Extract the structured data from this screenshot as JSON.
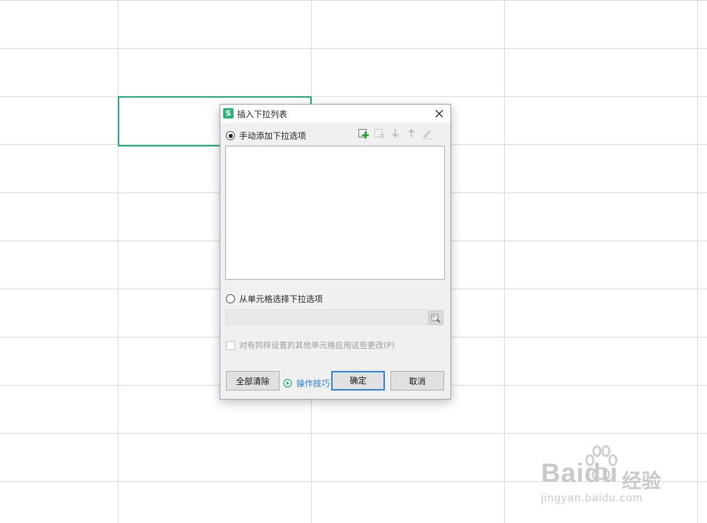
{
  "dialog": {
    "title": "插入下拉列表",
    "manual_option_label": "手动添加下拉选项",
    "manual_option_selected": true,
    "cell_option_label": "从单元格选择下拉选项",
    "cell_option_selected": false,
    "range_value": "",
    "apply_checkbox_label": "对有同样设置的其他单元格应用这些更改(P)",
    "apply_checkbox_checked": false,
    "buttons": {
      "clear_all": "全部清除",
      "tips": "操作技巧",
      "ok": "确定",
      "cancel": "取消"
    },
    "toolbar_icons": [
      "add-item-icon",
      "delete-item-icon",
      "move-down-icon",
      "move-up-icon",
      "edit-item-icon"
    ],
    "accent_color": "#2b7fd6",
    "add_icon_color": "#1aa82f"
  },
  "app": {
    "logo_glyph": "S",
    "logo_color": "#2fb37d",
    "selection_color": "#1aa876"
  },
  "watermark": {
    "brand": "Bai",
    "brand_suffix": "du",
    "cn_text": "经验",
    "url": "jingyan.baidu.com"
  }
}
